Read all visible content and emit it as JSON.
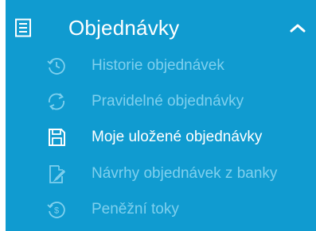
{
  "menu": {
    "title": "Objednávky",
    "header_icon": "document-list-icon",
    "toggle_icon": "chevron-up-icon",
    "colors": {
      "background": "#109bd0",
      "text_active": "#ffffff",
      "text_muted": "#7fd0ee"
    },
    "items": [
      {
        "label": "Historie objednávek",
        "icon": "history-icon",
        "active": false
      },
      {
        "label": "Pravidelné objednávky",
        "icon": "recurring-icon",
        "active": false
      },
      {
        "label": "Moje uložené objednávky",
        "icon": "save-icon",
        "active": true
      },
      {
        "label": "Návrhy objednávek z banky",
        "icon": "edit-document-icon",
        "active": false
      },
      {
        "label": "Peněžní toky",
        "icon": "money-icon",
        "active": false
      }
    ]
  }
}
